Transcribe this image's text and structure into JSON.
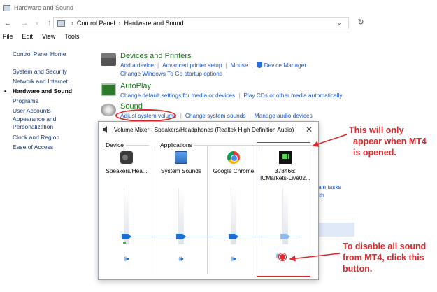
{
  "window": {
    "title": "Hardware and Sound"
  },
  "nav": {
    "back": "←",
    "forward": "→",
    "down": "˅",
    "up": "↑",
    "refresh": "↻"
  },
  "address": {
    "crumbs": [
      "Control Panel",
      "Hardware and Sound"
    ],
    "separator": "›",
    "dropdown": "⌄"
  },
  "menu": [
    "File",
    "Edit",
    "View",
    "Tools"
  ],
  "sidebar": {
    "items": [
      {
        "label": "Control Panel Home"
      },
      {
        "label": "System and Security"
      },
      {
        "label": "Network and Internet"
      },
      {
        "label": "Hardware and Sound",
        "active": true
      },
      {
        "label": "Programs"
      },
      {
        "label": "User Accounts"
      },
      {
        "label": "Appearance and Personalization"
      },
      {
        "label": "Clock and Region"
      },
      {
        "label": "Ease of Access"
      }
    ]
  },
  "categories": {
    "devices": {
      "title": "Devices and Printers",
      "links": [
        "Add a device",
        "Advanced printer setup",
        "Mouse",
        "Device Manager"
      ],
      "links2": [
        "Change Windows To Go startup options"
      ],
      "icon": "printer-icon"
    },
    "autoplay": {
      "title": "AutoPlay",
      "links": [
        "Change default settings for media or devices",
        "Play CDs or other media automatically"
      ],
      "icon": "autoplay-icon"
    },
    "sound": {
      "title": "Sound",
      "links": [
        "Adjust system volume",
        "Change system sounds",
        "Manage audio devices"
      ],
      "icon": "sound-icon"
    }
  },
  "background_fragments": [
    "ain tasks",
    "ith"
  ],
  "mixer": {
    "title": "Volume Mixer - Speakers/Headphones (Realtek High Definition Audio)",
    "close": "✕",
    "device_label": "Device",
    "applications_label": "Applications",
    "channels": [
      {
        "name": "Speakers/Hea...",
        "icon": "speakers-icon",
        "level": 0.0,
        "muted": false
      },
      {
        "name": "System Sounds",
        "icon": "system-sounds-icon",
        "level": 0.0,
        "muted": false
      },
      {
        "name": "Google Chrome",
        "icon": "chrome-icon",
        "level": 0.0,
        "muted": false
      },
      {
        "name": "378466:",
        "name2": "ICMarkets-Live02...",
        "icon": "mt4-icon",
        "level": 0.0,
        "muted": true
      }
    ],
    "speaker_glyph": "🕪"
  },
  "annotations": {
    "top": [
      "This will only",
      "appear when MT4",
      "is opened."
    ],
    "bottom": [
      "To disable all sound",
      "from MT4, click this",
      "button."
    ],
    "color": "#e0262b"
  }
}
